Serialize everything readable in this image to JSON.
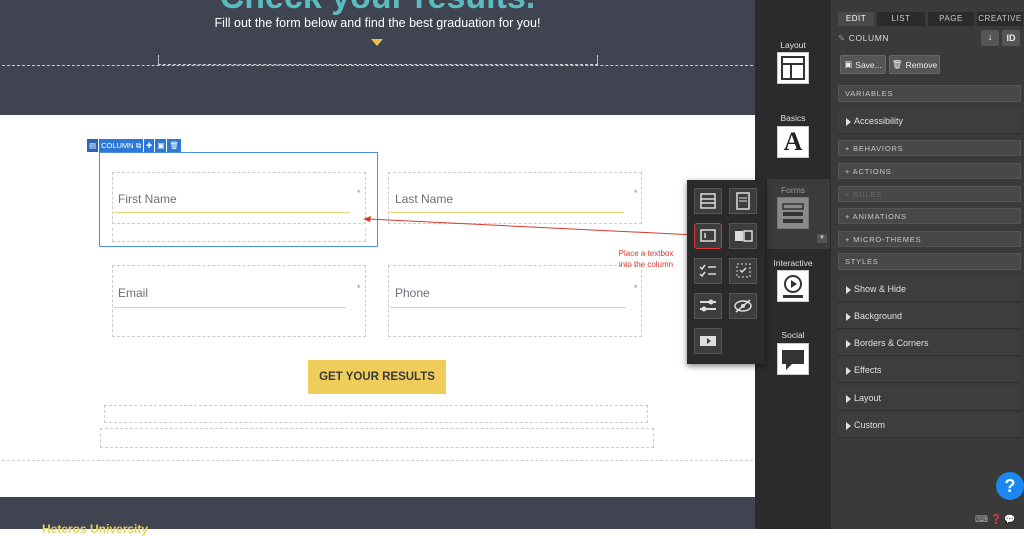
{
  "hero": {
    "title": "Check your results.",
    "subtitle": "Fill out the form below and find the best graduation for you!"
  },
  "form": {
    "first_name": "First Name",
    "last_name": "Last Name",
    "email": "Email",
    "phone": "Phone",
    "required_mark": "*",
    "cta": "GET YOUR RESULTS"
  },
  "column_toolbar": {
    "label": "COLUMN"
  },
  "footer": {
    "text": "Heteros University"
  },
  "annotation": {
    "text": "Place a textbox into the column"
  },
  "palette": {
    "categories": [
      {
        "label": "Layout",
        "icon": "layout-grid-icon"
      },
      {
        "label": "Basics",
        "icon": "letter-a-icon"
      },
      {
        "label": "Forms",
        "icon": "form-icon"
      },
      {
        "label": "Interactive",
        "icon": "play-circle-icon"
      },
      {
        "label": "Social",
        "icon": "chat-bubble-icon"
      }
    ],
    "basics_glyph": "A"
  },
  "panel": {
    "tabs": [
      "EDIT",
      "LIST",
      "PAGE",
      "CREATIVE"
    ],
    "active_tab": "EDIT",
    "element_name": "COLUMN",
    "id_button": "ID",
    "save_button": "Save...",
    "remove_button": "Remove",
    "sections": {
      "variables": "VARIABLES",
      "behaviors": "+ BEHAVIORS",
      "actions": "+ ACTIONS",
      "rules": "+ RULES",
      "animations": "+ ANIMATIONS",
      "micro_themes": "+ MICRO-THEMES",
      "styles": "STYLES"
    },
    "variables_rows": [
      "Accessibility"
    ],
    "style_rows": [
      "Show & Hide",
      "Background",
      "Borders & Corners",
      "Effects",
      "Layout",
      "Custom"
    ]
  },
  "help": "?",
  "colors": {
    "accent_blue": "#2f79d6",
    "cta_yellow": "#f0cd5a",
    "hero_bg": "#3f4450",
    "title_teal": "#5bbcbf"
  }
}
